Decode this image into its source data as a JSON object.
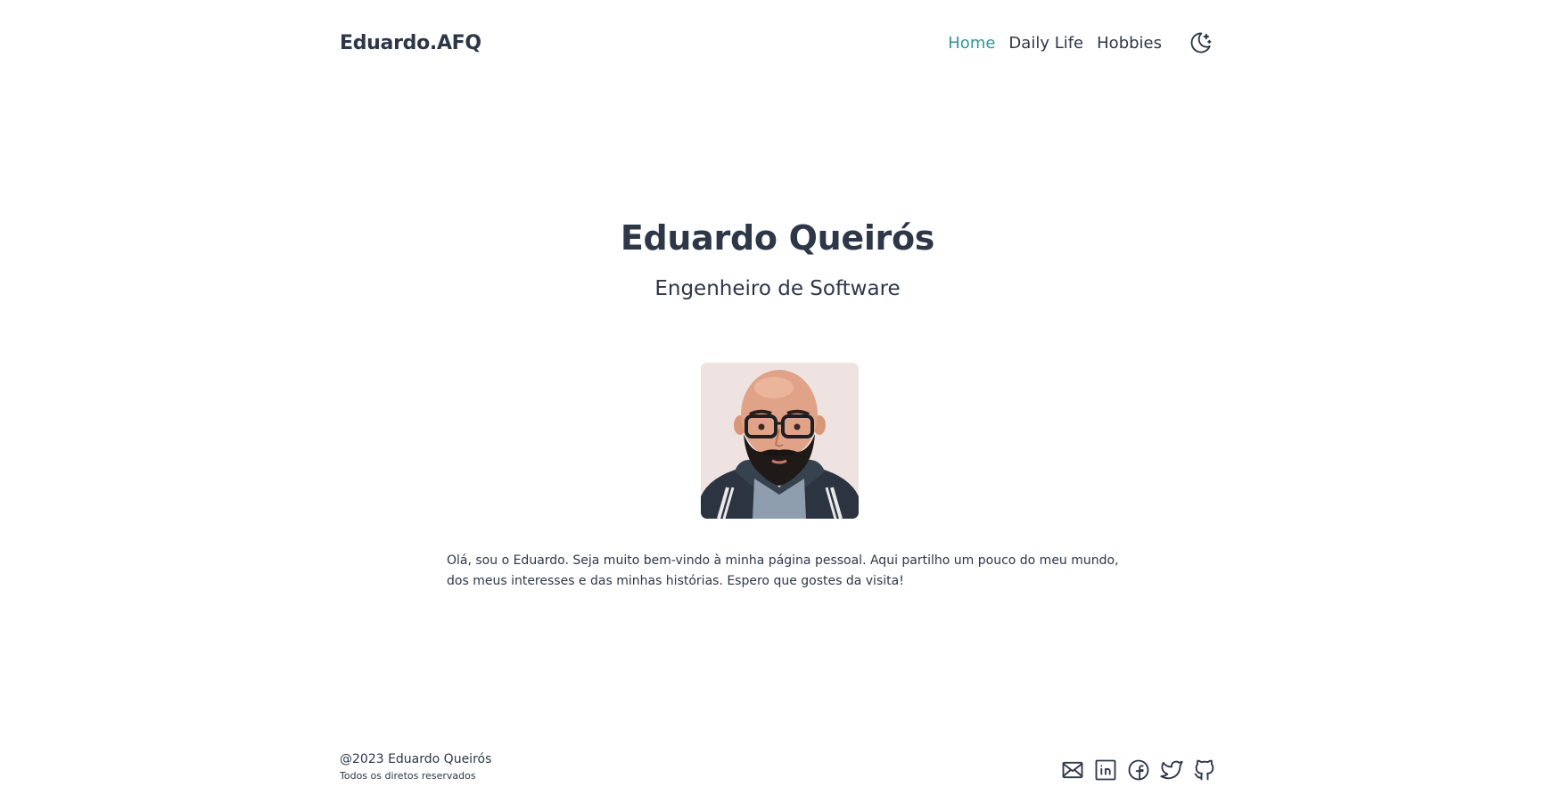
{
  "header": {
    "brand": "Eduardo.AFQ",
    "nav": [
      {
        "label": "Home",
        "active": true
      },
      {
        "label": "Daily Life",
        "active": false
      },
      {
        "label": "Hobbies",
        "active": false
      }
    ],
    "theme_toggle_icon": "moon-stars-icon"
  },
  "hero": {
    "name": "Eduardo Queirós",
    "role": "Engenheiro de Software",
    "avatar_icon": "avatar-illustration"
  },
  "intro": "Olá, sou o Eduardo. Seja muito bem-vindo à minha página pessoal. Aqui partilho um pouco do meu mundo, dos meus interesses e das minhas histórias. Espero que gostes da visita!",
  "footer": {
    "copyright": "@2023 Eduardo Queirós",
    "rights": "Todos os diretos reservados",
    "social_icons": [
      "mail-icon",
      "linkedin-icon",
      "facebook-icon",
      "twitter-icon",
      "github-icon"
    ]
  },
  "colors": {
    "text": "#2d3748",
    "accent": "#319795",
    "background": "#ffffff"
  }
}
